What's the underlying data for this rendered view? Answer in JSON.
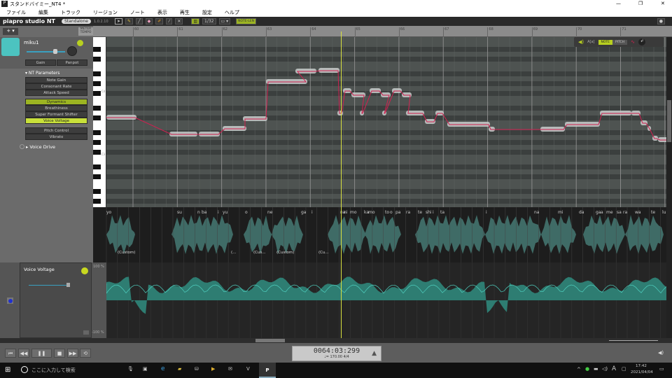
{
  "window": {
    "title": "スタンドバイミー_NT4 *",
    "controls": [
      "—",
      "❐",
      "✕"
    ]
  },
  "menu": [
    "ファイル",
    "編集",
    "トラック",
    "リージョン",
    "ノート",
    "表示",
    "再生",
    "設定",
    "ヘルプ"
  ],
  "toolbar": {
    "logo": "piapro studio NT",
    "mode": "Standalone",
    "version": "1.0.2.10",
    "quantize": "1/32",
    "tempo_btn": "NOTE-LEN"
  },
  "left": {
    "add": "+ ▾",
    "meter_tempo": "METER TEMPO",
    "track_name": "miku1",
    "gain": "Gain",
    "panpot": "Panpot",
    "nt_params": "NT Parameters",
    "params": [
      "Note Gain",
      "Consonant Rate",
      "Attack Speed"
    ],
    "curves": [
      "Dynamics",
      "Breathiness",
      "Super Formant Shifter",
      "Voice Voltage",
      "Pitch Control",
      "Vibrato"
    ],
    "voice_drive": "Voice Drive"
  },
  "ruler": {
    "bars": [
      "60",
      "61",
      "62",
      "63",
      "64",
      "65",
      "66",
      "67",
      "68",
      "69",
      "70",
      "71"
    ]
  },
  "roll": {
    "note_label": "NOTE",
    "pitch_label": "PITCH",
    "c4": "C4",
    "c3": "C3"
  },
  "lyrics": [
    "yo",
    "su",
    "n",
    "ba",
    "i",
    "yu",
    "o",
    "ne",
    "ga",
    "i",
    "na",
    "ni",
    "mo",
    "ka",
    "mo",
    "to",
    "o",
    "pa",
    "ra",
    "te",
    "shi",
    "i",
    "ta",
    "i",
    "na",
    "mi",
    "da",
    "ga",
    "a",
    "me",
    "sa",
    "ra",
    "wa",
    "te",
    "lu"
  ],
  "vibrato_labels": [
    "(Custom)",
    "(...",
    "(Cus...",
    "(Custom)",
    "(Cu..."
  ],
  "param_panel": {
    "name": "Voice Voltage",
    "max": "100 %",
    "min": "-100 %"
  },
  "transport": {
    "position": "0064:03:299",
    "tempo": "♩= 170.00",
    "meter": "4/4"
  },
  "taskbar": {
    "search": "ここに入力して検索",
    "time": "17:42",
    "date": "2021/04/04",
    "ime": "A"
  },
  "colors": {
    "accent": "#c8e03a",
    "pitch": "#d02050",
    "wave": "#3f6b66",
    "playhead": "#d8e040"
  }
}
